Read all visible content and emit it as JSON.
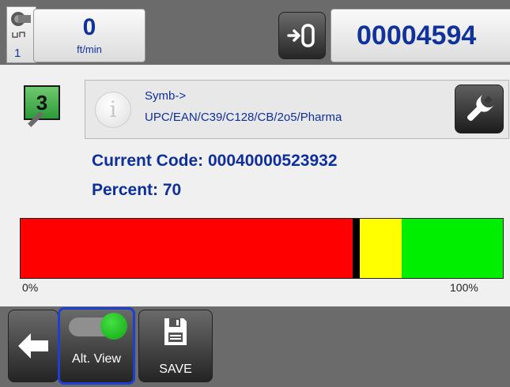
{
  "header": {
    "encoder_number": "1",
    "speed_value": "0",
    "speed_unit": "ft/min",
    "count_value": "00004594"
  },
  "info": {
    "badge_number": "3",
    "symb_label": "Symb->",
    "symb_value": "UPC/EAN/C39/C128/CB/2o5/Pharma"
  },
  "status": {
    "current_code_text": "Current Code:  00040000523932",
    "percent_text": "Percent: 70"
  },
  "gauge": {
    "percent": 70,
    "red_fraction": 0.69,
    "yellow_fraction": 0.1,
    "green_fraction": 0.21,
    "min_label": "0%",
    "max_label": "100%",
    "colors": {
      "red": "#ff0000",
      "yellow": "#ffff00",
      "green": "#00ee00"
    }
  },
  "buttons": {
    "alt_view_label": "Alt. View",
    "save_label": "SAVE",
    "alt_view_on": true
  },
  "icons": {
    "encoder": "encoder-icon",
    "direction": "arrow-into-box-icon",
    "info": "info-icon",
    "settings": "wrench-icon",
    "back": "back-arrow-icon",
    "toggle": "toggle-icon",
    "save": "floppy-disk-icon"
  },
  "theme": {
    "text_blue": "#0e2f9b",
    "bar_gray": "#6b6b6b",
    "selected_border": "#1f3fcf"
  }
}
